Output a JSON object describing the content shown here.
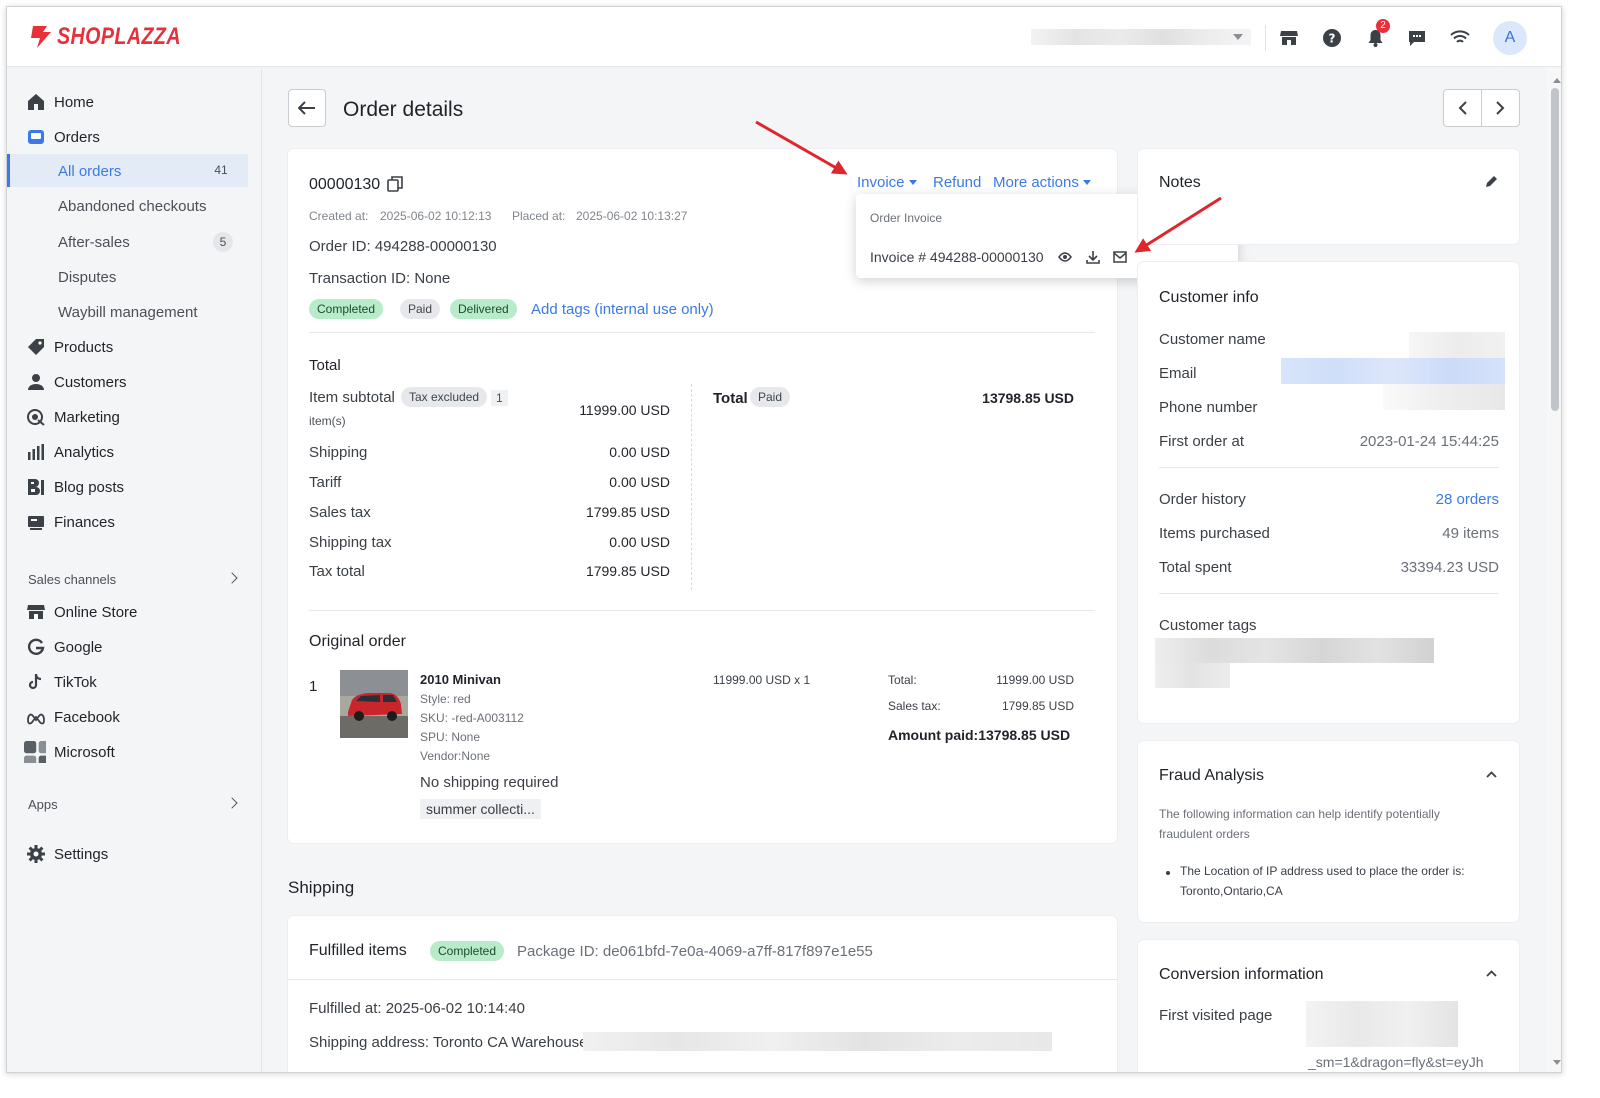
{
  "brand": {
    "name": "SHOPLAZZA",
    "color": "#e8303a"
  },
  "topbar": {
    "notification_count": "2",
    "avatar_initial": "A",
    "icons": [
      "store-icon",
      "help-icon",
      "bell-icon",
      "chat-icon",
      "wifi-icon"
    ]
  },
  "sidebar": {
    "items": [
      {
        "label": "Home",
        "icon": "home-icon"
      },
      {
        "label": "Orders",
        "icon": "orders-icon"
      },
      {
        "label": "Products",
        "icon": "tag-icon"
      },
      {
        "label": "Customers",
        "icon": "person-icon"
      },
      {
        "label": "Marketing",
        "icon": "marketing-icon"
      },
      {
        "label": "Analytics",
        "icon": "bar-chart-icon"
      },
      {
        "label": "Blog posts",
        "icon": "blog-icon"
      },
      {
        "label": "Finances",
        "icon": "finance-icon"
      }
    ],
    "orders_sub": [
      {
        "label": "All orders",
        "count": "41"
      },
      {
        "label": "Abandoned checkouts"
      },
      {
        "label": "After-sales",
        "count": "5"
      },
      {
        "label": "Disputes"
      },
      {
        "label": "Waybill management"
      }
    ],
    "sales_channels_title": "Sales channels",
    "channels": [
      {
        "label": "Online Store",
        "icon": "store-icon"
      },
      {
        "label": "Google",
        "icon": "google-icon"
      },
      {
        "label": "TikTok",
        "icon": "tiktok-icon"
      },
      {
        "label": "Facebook",
        "icon": "meta-icon"
      },
      {
        "label": "Microsoft",
        "icon": "microsoft-icon"
      }
    ],
    "apps_title": "Apps",
    "settings": "Settings"
  },
  "page": {
    "title": "Order details"
  },
  "order": {
    "number": "00000130",
    "actions": {
      "invoice": "Invoice",
      "refund": "Refund",
      "more": "More actions"
    },
    "created_label": "Created at:",
    "created_value": "2025-06-02 10:12:13",
    "placed_label": "Placed at:",
    "placed_value": "2025-06-02 10:13:27",
    "order_id": "Order ID: 494288-00000130",
    "transaction_id": "Transaction ID: None",
    "tags": [
      "Completed",
      "Paid",
      "Delivered"
    ],
    "add_tags": "Add tags (internal use only)",
    "invoice_menu": {
      "title": "Order Invoice",
      "item": "Invoice # 494288-00000130"
    }
  },
  "totals": {
    "heading": "Total",
    "item_subtotal": "Item subtotal",
    "tax_excluded": "Tax excluded",
    "items_count": "1",
    "items_unit": "item(s)",
    "item_subtotal_value": "11999.00 USD",
    "rows": [
      {
        "label": "Shipping",
        "value": "0.00 USD"
      },
      {
        "label": "Tariff",
        "value": "0.00 USD"
      },
      {
        "label": "Sales tax",
        "value": "1799.85 USD"
      },
      {
        "label": "Shipping tax",
        "value": "0.00 USD"
      },
      {
        "label": "Tax total",
        "value": "1799.85 USD"
      }
    ],
    "total_label": "Total",
    "paid_badge": "Paid",
    "total_value": "13798.85 USD"
  },
  "original_order": {
    "heading": "Original order",
    "index": "1",
    "product_name": "2010 Minivan",
    "style": "Style: red",
    "sku": "SKU: -red-A003112",
    "spu": "SPU: None",
    "vendor": "Vendor:None",
    "price_qty": "11999.00 USD x 1",
    "total_label": "Total:",
    "total_value": "11999.00 USD",
    "sales_tax_label": "Sales tax:",
    "sales_tax_value": "1799.85 USD",
    "amount_paid": "Amount paid:13798.85 USD",
    "shipping_note": "No shipping required",
    "collection_tag": "summer collecti..."
  },
  "shipping": {
    "heading": "Shipping",
    "fulfilled_items": "Fulfilled items",
    "status": "Completed",
    "package_id": "Package ID: de061bfd-7e0a-4069-a7ff-817f897e1e55",
    "fulfilled_at": "Fulfilled at:  2025-06-02 10:14:40",
    "address": "Shipping address: Toronto CA Warehouse"
  },
  "notes": {
    "title": "Notes"
  },
  "customer": {
    "title": "Customer info",
    "name_label": "Customer name",
    "email_label": "Email",
    "phone_label": "Phone number",
    "first_order_label": "First order at",
    "first_order_value": "2023-01-24 15:44:25",
    "history_label": "Order history",
    "history_value": "28 orders",
    "items_label": "Items purchased",
    "items_value": "49 items",
    "spent_label": "Total spent",
    "spent_value": "33394.23 USD",
    "tags_label": "Customer tags"
  },
  "fraud": {
    "title": "Fraud Analysis",
    "desc1": "The following information can help identify potentially",
    "desc2": "fraudulent orders",
    "bullet1": "The Location of IP address used to place the order is:",
    "bullet2": "Toronto,Ontario,CA"
  },
  "conversion": {
    "title": "Conversion information",
    "first_visited": "First visited page",
    "url_fragment": "_sm=1&dragon=fly&st=eyJh"
  }
}
